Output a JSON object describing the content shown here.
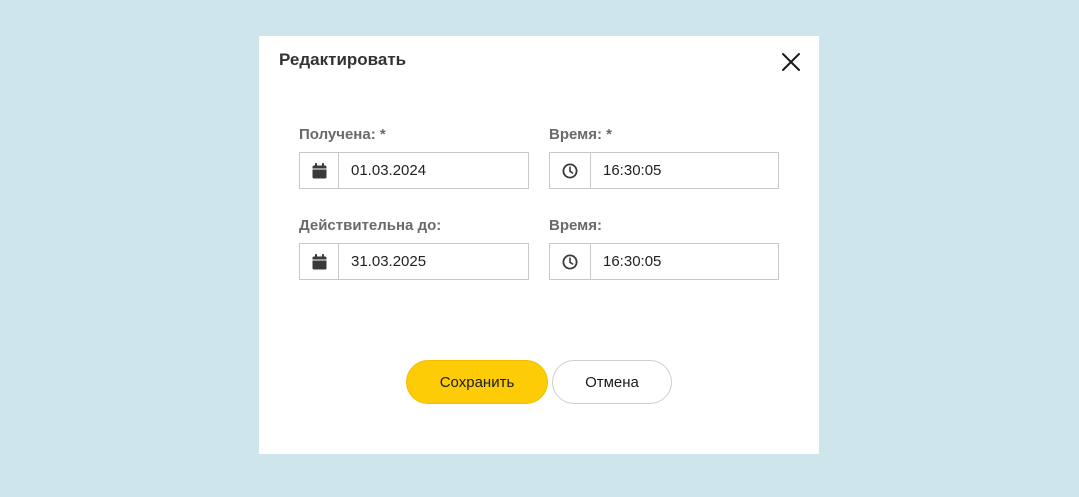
{
  "dialog": {
    "title": "Редактировать",
    "close_icon": "close-icon"
  },
  "fields": {
    "received_date": {
      "label": "Получена: *",
      "value": "01.03.2024",
      "icon": "calendar-icon"
    },
    "received_time": {
      "label": "Время: *",
      "value": "16:30:05",
      "icon": "clock-icon"
    },
    "valid_until_date": {
      "label": "Действительна до:",
      "value": "31.03.2025",
      "icon": "calendar-icon"
    },
    "valid_until_time": {
      "label": "Время:",
      "value": "16:30:05",
      "icon": "clock-icon"
    }
  },
  "buttons": {
    "save_label": "Сохранить",
    "cancel_label": "Отмена"
  },
  "colors": {
    "background": "#cfe5ec",
    "dialog": "#ffffff",
    "save_button": "#fdcc06",
    "label_text": "#6a6a6a"
  }
}
